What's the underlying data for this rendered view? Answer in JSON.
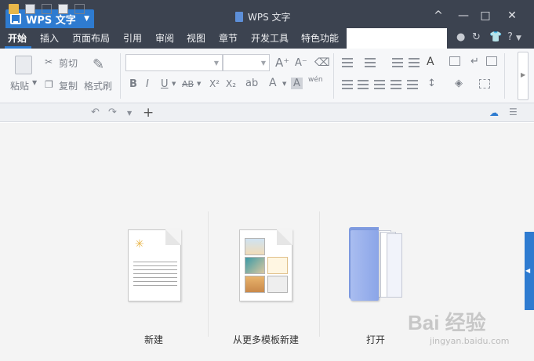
{
  "app": {
    "menu_label": "WPS 文字",
    "doc_title": "WPS 文字"
  },
  "window_controls": {
    "collapse": "^",
    "minimize": "—",
    "maximize": "□",
    "close": "✕"
  },
  "tabs": [
    {
      "label": "开始",
      "active": true
    },
    {
      "label": "插入",
      "active": false
    },
    {
      "label": "页面布局",
      "active": false
    },
    {
      "label": "引用",
      "active": false
    },
    {
      "label": "审阅",
      "active": false
    },
    {
      "label": "视图",
      "active": false
    },
    {
      "label": "章节",
      "active": false
    },
    {
      "label": "开发工具",
      "active": false
    },
    {
      "label": "特色功能",
      "active": false
    }
  ],
  "ribbon": {
    "paste": "粘贴",
    "cut": "剪切",
    "copy": "复制",
    "format_painter": "格式刷",
    "font_name": "",
    "font_size": "",
    "bold": "B",
    "italic": "I",
    "underline": "U",
    "strike": "AB",
    "superscript": "X²",
    "subscript": "X₂",
    "font_color": "A",
    "grow_font": "A⁺",
    "shrink_font": "A⁻",
    "char_shading": "A",
    "pinyin": "wén"
  },
  "help_label": "?",
  "main": {
    "new_label": "新建",
    "template_label": "从更多模板新建",
    "open_label": "打开"
  },
  "watermark": {
    "brand": "Bai 经验",
    "url": "jingyan.baidu.com"
  },
  "colors": {
    "titlebar": "#3c4350",
    "accent": "#2e7bd0",
    "folder": "#8ba5e8"
  }
}
